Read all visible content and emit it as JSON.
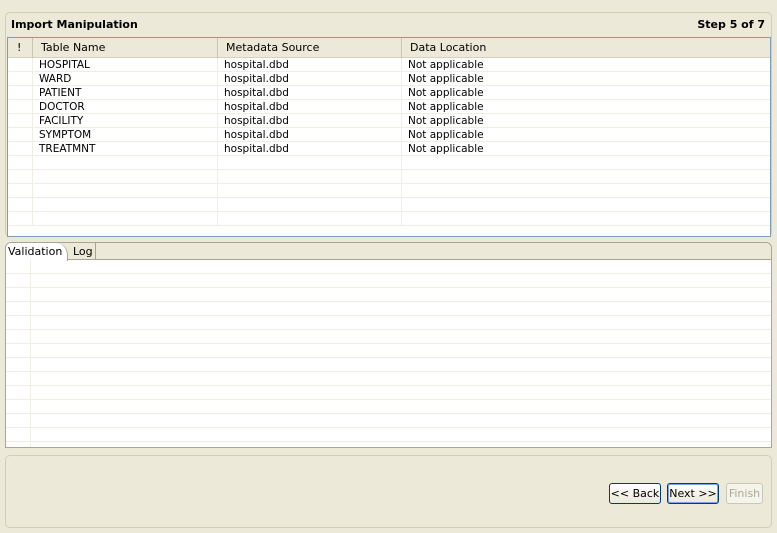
{
  "header": {
    "title": "Import Manipulation",
    "step": "Step 5 of 7"
  },
  "table": {
    "columns": [
      "!",
      "Table Name",
      "Metadata Source",
      "Data Location"
    ],
    "rows": [
      [
        "",
        "HOSPITAL",
        "hospital.dbd",
        "Not applicable"
      ],
      [
        "",
        "WARD",
        "hospital.dbd",
        "Not applicable"
      ],
      [
        "",
        "PATIENT",
        "hospital.dbd",
        "Not applicable"
      ],
      [
        "",
        "DOCTOR",
        "hospital.dbd",
        "Not applicable"
      ],
      [
        "",
        "FACILITY",
        "hospital.dbd",
        "Not applicable"
      ],
      [
        "",
        "SYMPTOM",
        "hospital.dbd",
        "Not applicable"
      ],
      [
        "",
        "TREATMNT",
        "hospital.dbd",
        "Not applicable"
      ]
    ]
  },
  "tabs": [
    {
      "label": "Validation",
      "active": true
    },
    {
      "label": "Log",
      "active": false
    }
  ],
  "buttons": {
    "back": "<< Back",
    "next": "Next >>",
    "finish": "Finish"
  }
}
